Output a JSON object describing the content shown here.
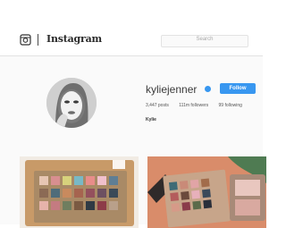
{
  "nav": {
    "wordmark": "Instagram",
    "search_placeholder": "Search"
  },
  "profile": {
    "username": "kyliejenner",
    "follow_label": "Follow",
    "stats": [
      "3,447 posts",
      "111m followers",
      "99 following"
    ],
    "bio_name": "Kylie",
    "bio_text": "",
    "bio_link": ""
  },
  "colors": {
    "accent": "#3897f0",
    "background": "#fafafa"
  }
}
